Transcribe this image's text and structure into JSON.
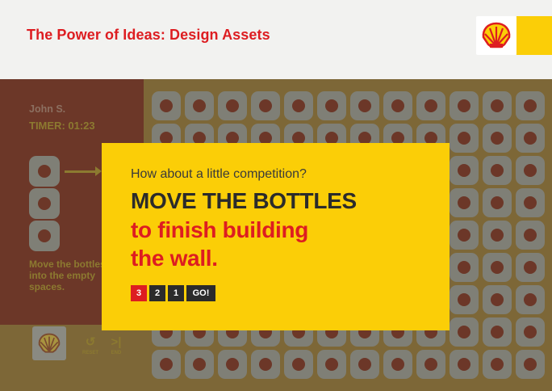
{
  "header": {
    "title": "The Power of Ideas: Design Assets"
  },
  "brand": {
    "logo_icon": "shell-pecten-icon",
    "red": "#dd1d21",
    "yellow": "#fbce07"
  },
  "game": {
    "player_name": "John S.",
    "timer": "TIMER: 01:23",
    "instructions": "Move the bottles into the empty spaces.",
    "controls": {
      "reset_label": "RESET",
      "end_label": "END"
    }
  },
  "modal": {
    "subtitle": "How about a little competition?",
    "headline": "MOVE THE BOTTLES",
    "line2": "to finish building",
    "line3": "the wall.",
    "countdown": [
      "3",
      "2",
      "1",
      "GO!"
    ]
  }
}
